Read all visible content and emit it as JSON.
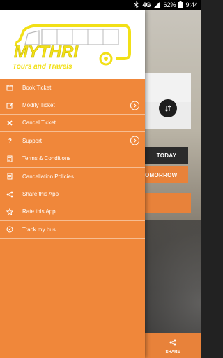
{
  "status_bar": {
    "network": "4G",
    "battery_percent": "62%",
    "time": "9:44"
  },
  "drawer": {
    "logo": {
      "brand": "MYTHRI",
      "tagline": "Tours and Travels"
    },
    "menu_items": [
      {
        "label": "Book Ticket",
        "icon": "ticket-icon",
        "has_chevron": false
      },
      {
        "label": "Modify Ticket",
        "icon": "edit-icon",
        "has_chevron": true
      },
      {
        "label": "Cancel Ticket",
        "icon": "close-icon",
        "has_chevron": false
      },
      {
        "label": "Support",
        "icon": "question-icon",
        "has_chevron": true
      },
      {
        "label": "Terms & Conditions",
        "icon": "document-icon",
        "has_chevron": false
      },
      {
        "label": "Cancellation Policies",
        "icon": "document-icon",
        "has_chevron": false
      },
      {
        "label": "Share this App",
        "icon": "share-icon",
        "has_chevron": false
      },
      {
        "label": "Rate this App",
        "icon": "star-icon",
        "has_chevron": false
      },
      {
        "label": "Track my bus",
        "icon": "compass-icon",
        "has_chevron": false
      }
    ]
  },
  "background": {
    "swap_icon": "swap-icon",
    "today_button": "TODAY",
    "tomorrow_button": "OMORROW",
    "bottom_share_label": "SHARE"
  },
  "colors": {
    "drawer": "#f0873a",
    "accent_orange": "#e8823a",
    "logo_yellow": "#f2e017",
    "dark_button": "#2b2b2b"
  }
}
